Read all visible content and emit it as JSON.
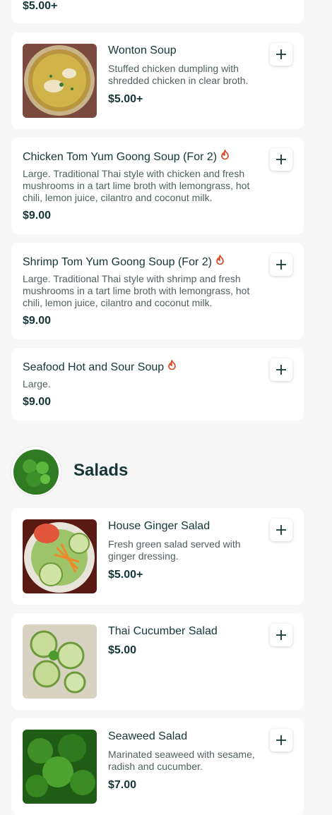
{
  "top_card": {
    "price": "$5.00+"
  },
  "items": [
    {
      "title": "Wonton Soup",
      "description": "Stuffed chicken dumpling with shredded chicken in clear broth.",
      "price": "$5.00+"
    },
    {
      "title": "Chicken Tom Yum Goong Soup (For 2)",
      "description": "Large. Traditional Thai style with chicken and fresh mushrooms in a tart lime broth with lemongrass, hot chili, lemon juice, cilantro and coconut milk.",
      "price": "$9.00"
    },
    {
      "title": "Shrimp Tom Yum Goong Soup (For 2)",
      "description": "Large. Traditional Thai style with shrimp and fresh mushrooms in a tart lime broth with lemongrass, hot chili, lemon juice, cilantro and coconut milk.",
      "price": "$9.00"
    },
    {
      "title": "Seafood Hot and Sour Soup",
      "description": "Large.",
      "price": "$9.00"
    }
  ],
  "section": {
    "title": "Salads"
  },
  "salads": [
    {
      "title": "House Ginger Salad",
      "description": "Fresh green salad served with ginger dressing.",
      "price": "$5.00+"
    },
    {
      "title": "Thai Cucumber Salad",
      "price": "$5.00"
    },
    {
      "title": "Seaweed Salad",
      "description": "Marinated seaweed with sesame, radish and cucumber.",
      "price": "$7.00"
    }
  ],
  "icons": {
    "add": "plus-icon",
    "spicy": "flame-icon"
  },
  "colors": {
    "text": "#163636",
    "spicy": "#d9431e",
    "card": "#ffffff",
    "background": "#f6f7f6"
  }
}
